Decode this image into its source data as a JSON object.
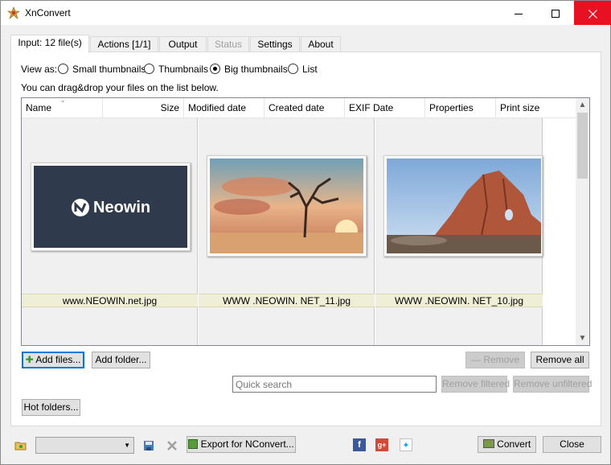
{
  "window": {
    "title": "XnConvert"
  },
  "tabs": [
    {
      "label": "Input: 12 file(s)",
      "active": true
    },
    {
      "label": "Actions [1/1]"
    },
    {
      "label": "Output"
    },
    {
      "label": "Status",
      "disabled": true
    },
    {
      "label": "Settings"
    },
    {
      "label": "About"
    }
  ],
  "view": {
    "label": "View as:",
    "options": [
      "Small thumbnails",
      "Thumbnails",
      "Big thumbnails",
      "List"
    ],
    "selected": "Big thumbnails",
    "hint": "You can drag&drop your files on the list below."
  },
  "columns": [
    "Name",
    "Size",
    "Modified date",
    "Created date",
    "EXIF Date",
    "Properties",
    "Print size"
  ],
  "files": [
    {
      "name": "www.NEOWIN.net.jpg",
      "thumb_text": "Neowin"
    },
    {
      "name": "WWW .NEOWIN. NET_11.jpg"
    },
    {
      "name": "WWW .NEOWIN. NET_10.jpg"
    }
  ],
  "buttons": {
    "add_files": "Add files...",
    "add_folder": "Add folder...",
    "remove": "Remove",
    "remove_all": "Remove all",
    "remove_filtered": "Remove filtered",
    "remove_unfiltered": "Remove unfiltered",
    "hot_folders": "Hot folders...",
    "export_nconvert": "Export for NConvert...",
    "convert": "Convert",
    "close": "Close"
  },
  "search": {
    "placeholder": "Quick search"
  },
  "icons": {
    "app": "xnconvert-logo-icon",
    "folder": "open-folder-icon",
    "save": "save-disk-icon",
    "delete": "delete-x-icon",
    "facebook": "facebook-icon",
    "googleplus": "google-plus-icon",
    "twitter": "twitter-icon"
  },
  "colors": {
    "caption_bg": "#efefd8",
    "close_red": "#e81123",
    "focus_blue": "#0078d7",
    "neowin_bg": "#2f3b4d"
  }
}
